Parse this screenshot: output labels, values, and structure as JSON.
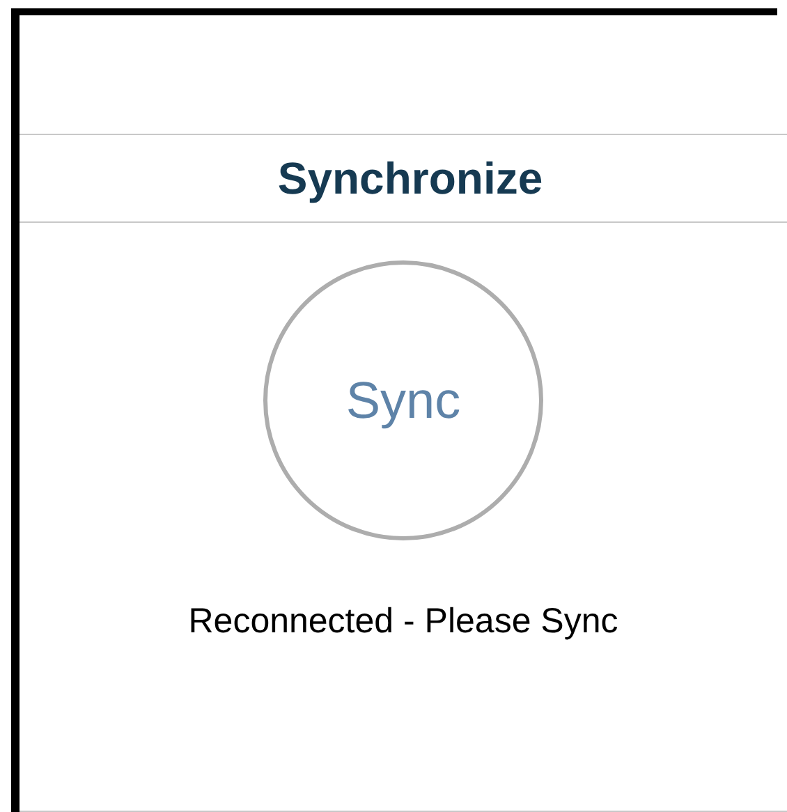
{
  "header": {
    "title": "Synchronize"
  },
  "sync_button": {
    "label": "Sync"
  },
  "status": "Reconnected - Please Sync"
}
